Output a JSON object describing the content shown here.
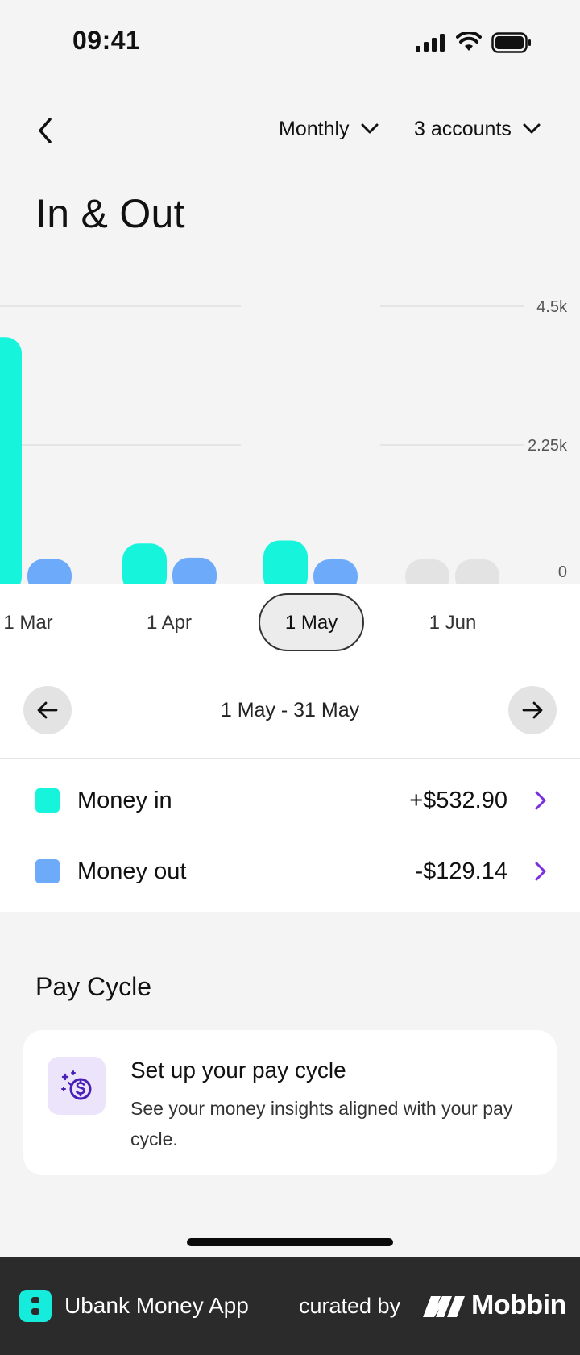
{
  "status_bar": {
    "time": "09:41"
  },
  "header": {
    "period_label": "Monthly",
    "accounts_label": "3 accounts"
  },
  "page_title": "In & Out",
  "colors": {
    "money_in": "#16f5dc",
    "money_out": "#6eaafa",
    "future": "#e3e3e3",
    "accent_chevron": "#7b2fe0"
  },
  "chart_data": {
    "type": "bar",
    "categories": [
      "1 Mar",
      "1 Apr",
      "1 May",
      "1 Jun"
    ],
    "series": [
      {
        "name": "Money in",
        "values": [
          4000,
          650,
          700,
          0
        ]
      },
      {
        "name": "Money out",
        "values": [
          400,
          420,
          380,
          0
        ]
      }
    ],
    "y_ticks": [
      "4.5k",
      "2.25k",
      "0"
    ],
    "ylim": [
      0,
      4500
    ],
    "grid": true,
    "selected_category": "1 May"
  },
  "months": [
    {
      "label": "1 Mar",
      "selected": false
    },
    {
      "label": "1 Apr",
      "selected": false
    },
    {
      "label": "1 May",
      "selected": true
    },
    {
      "label": "1 Jun",
      "selected": false
    }
  ],
  "date_nav": {
    "range": "1 May - 31 May"
  },
  "money": [
    {
      "label": "Money in",
      "value": "+$532.90"
    },
    {
      "label": "Money out",
      "value": "-$129.14"
    }
  ],
  "pay_cycle": {
    "section_title": "Pay Cycle",
    "card_title": "Set up your pay cycle",
    "card_desc": "See your money insights aligned with your pay cycle."
  },
  "footer": {
    "app_name": "Ubank Money App",
    "curated_by": "curated by",
    "brand": "Mobbin"
  }
}
